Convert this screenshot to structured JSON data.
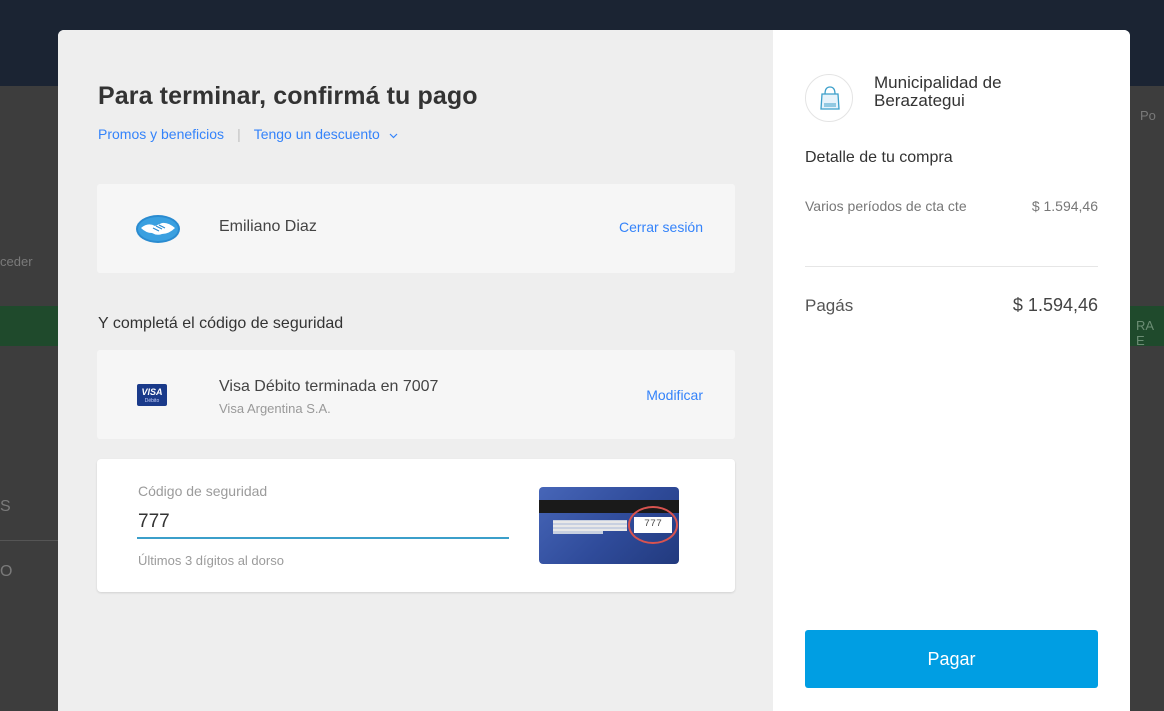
{
  "background": {
    "left_text_1": "ceder",
    "right_text_1": "Po",
    "right_band_text": "RA E",
    "left_letter_1": "S",
    "left_letter_2": "O"
  },
  "checkout": {
    "title": "Para terminar, confirmá tu pago",
    "links": {
      "promos": "Promos y beneficios",
      "separator": "|",
      "discount": "Tengo un descuento",
      "discount_icon": "chevron-down-icon"
    },
    "user": {
      "name": "Emiliano Diaz",
      "logout_label": "Cerrar sesión",
      "icon": "handshake-icon"
    },
    "security_section_title": "Y completá el código de seguridad",
    "payment_method": {
      "brand": "VISA",
      "brand_sub": "Débito",
      "name": "Visa Débito terminada en 7007",
      "issuer": "Visa Argentina S.A.",
      "modify_label": "Modificar"
    },
    "security_code": {
      "label": "Código de seguridad",
      "value": "777",
      "help": "Últimos 3 dígitos al dorso",
      "card_code": "777"
    }
  },
  "summary": {
    "merchant": "Municipalidad de Berazategui",
    "merchant_icon": "shopping-bag-icon",
    "detail_title": "Detalle de tu compra",
    "item": {
      "name": "Varios períodos de cta cte",
      "amount": "$ 1.594,46"
    },
    "total_label": "Pagás",
    "total_amount": "$ 1.594,46",
    "pay_button": "Pagar"
  },
  "colors": {
    "link_blue": "#3483fa",
    "pay_button": "#009ee3",
    "input_underline": "#3b9fca",
    "card_highlight": "#d9534f"
  }
}
